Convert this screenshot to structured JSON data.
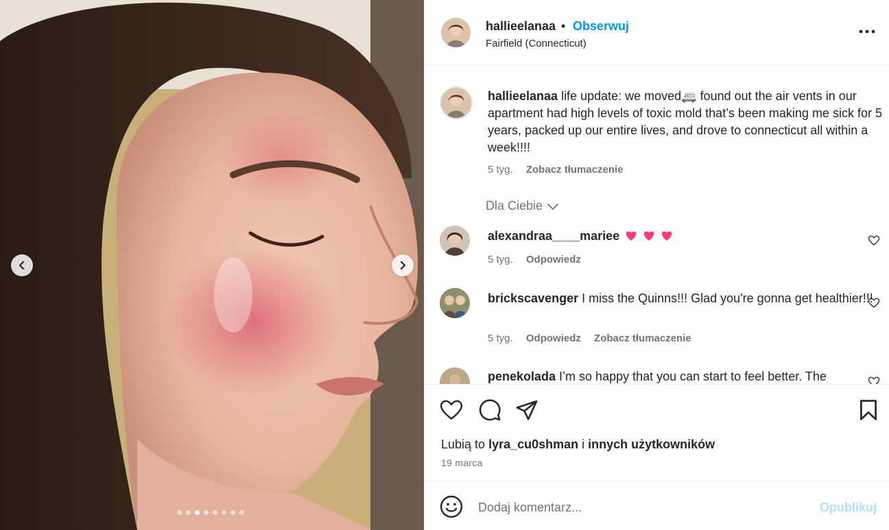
{
  "photo": {
    "description_icon": "photo",
    "prev_icon": "chevron-left-icon",
    "next_icon": "chevron-right-icon",
    "dots_total": 8,
    "dots_active_index": 2
  },
  "header": {
    "username": "hallieelanaa",
    "separator": "•",
    "follow_label": "Obserwuj",
    "location": "Fairfield (Connecticut)",
    "more_icon": "more-horizontal-icon"
  },
  "caption": {
    "username": "hallieelanaa",
    "text_before_emoji": " life update: we moved",
    "emoji": "🚐",
    "text_after_emoji": " found out the air vents in our apartment had high levels of toxic mold that’s been making me sick for 5 years, packed up our entire lives, and drove to connecticut all within a week!!!!",
    "time": "5 tyg.",
    "translate": "Zobacz tłumaczenie"
  },
  "for_you": {
    "label": "Dla Ciebie"
  },
  "comments": [
    {
      "username": "alexandraa____mariee",
      "text": " ",
      "emoji": "💗💗💗",
      "time": "5 tyg.",
      "reply": "Odpowiedz",
      "translate": ""
    },
    {
      "username": "brickscavenger",
      "text": " I miss the Quinns!!! Glad you're gonna get healthier!!!",
      "emoji": "",
      "time": "5 tyg.",
      "reply": "Odpowiedz",
      "translate": "Zobacz tłumaczenie"
    },
    {
      "username": "penekolada",
      "text": " I’m so happy that you can start to feel better. The",
      "emoji": "",
      "time": "",
      "reply": "",
      "translate": ""
    }
  ],
  "actions": {
    "like_icon": "heart-icon",
    "comment_icon": "comment-icon",
    "share_icon": "send-icon",
    "save_icon": "bookmark-icon",
    "likes_prefix": "Lubią to ",
    "likes_user": "lyra_cu0shman",
    "likes_mid": " i ",
    "likes_others": "innych użytkowników",
    "date": "19 marca"
  },
  "add_comment": {
    "emoji_icon": "smiley-icon",
    "placeholder": "Dodaj komentarz...",
    "publish_label": "Opublikuj"
  },
  "colors": {
    "accent": "#0095f6",
    "publish_disabled": "#b2dffc",
    "text": "#262626",
    "muted": "#737373",
    "heart": "#ff3d6e"
  }
}
